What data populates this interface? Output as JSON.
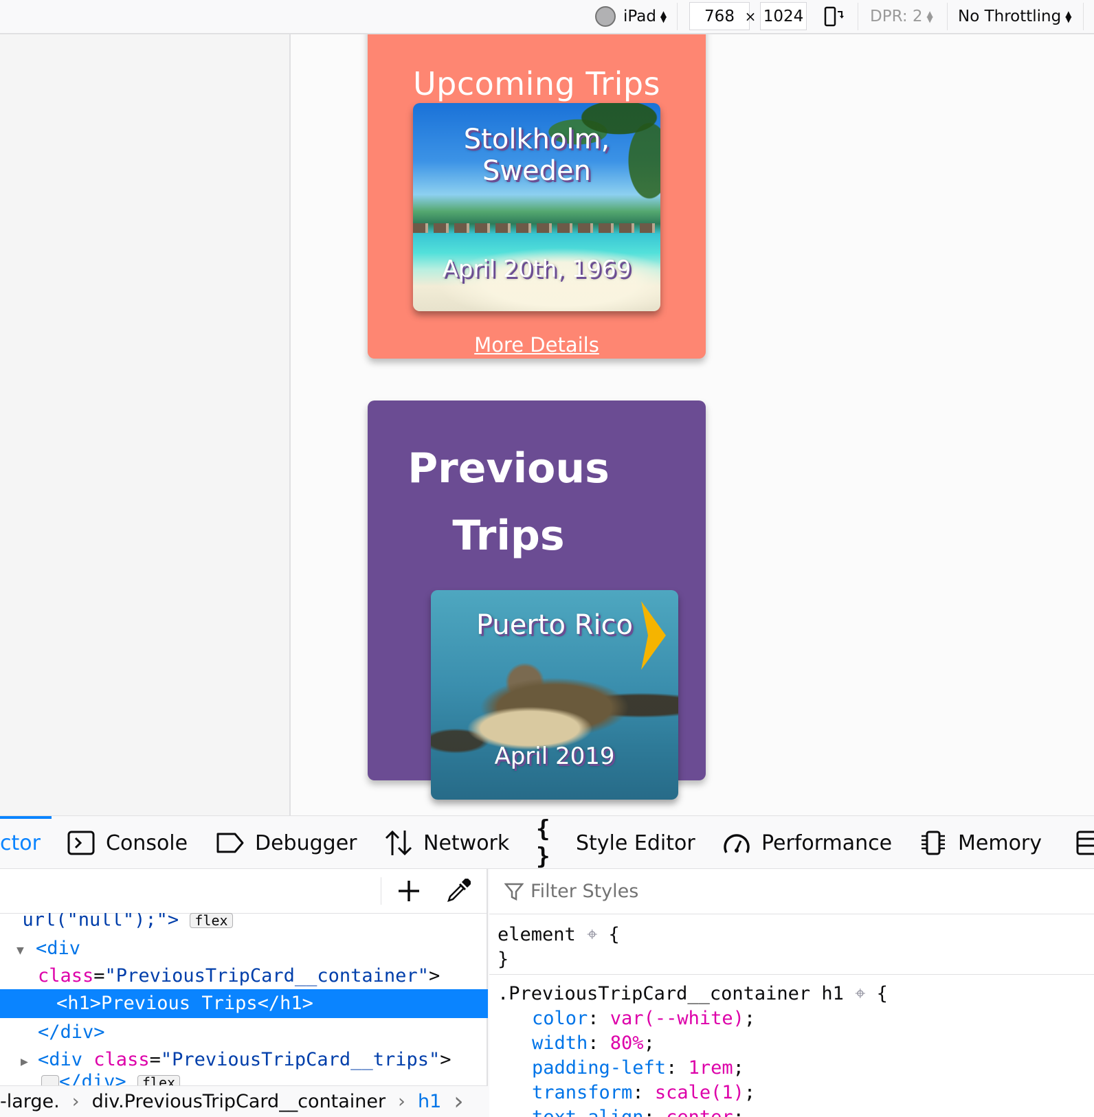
{
  "toolbar": {
    "device": "iPad",
    "width": "768",
    "times": "×",
    "height": "1024",
    "dpr": "DPR: 2",
    "throttling": "No Throttling"
  },
  "upcoming": {
    "title": "Upcoming Trips",
    "card_city": "Stolkholm, Sweden",
    "card_date": "April 20th, 1969",
    "more_link": "More Details"
  },
  "previous": {
    "title": "Previous Trips",
    "card_city": "Puerto Rico",
    "card_date": "April 2019"
  },
  "devtools": {
    "tabs": [
      {
        "label": "ctor",
        "icon": "inspector-icon"
      },
      {
        "label": "Console",
        "icon": "console-icon"
      },
      {
        "label": "Debugger",
        "icon": "debugger-icon"
      },
      {
        "label": "Network",
        "icon": "network-icon"
      },
      {
        "label": "Style Editor",
        "icon": "style-editor-icon"
      },
      {
        "label": "Performance",
        "icon": "performance-icon"
      },
      {
        "label": "Memory",
        "icon": "memory-icon"
      }
    ],
    "markup": {
      "line0_text": "url(\"null\");\">",
      "line0_badge": "flex",
      "div_open": "<div",
      "class_attr": "class",
      "eq": "=",
      "container_class": "\"PreviousTripCard__container\"",
      "gt": ">",
      "selected_line": "<h1>Previous Trips</h1>",
      "div_close": "</div>",
      "trips_class": "\"PreviousTripCard__trips\"",
      "ellipsis_badge": "…",
      "last_close": "</div>",
      "last_badge": "flex"
    },
    "breadcrumbs": [
      "-large.",
      "div.PreviousTripCard__container",
      "h1"
    ],
    "rules": {
      "filter_placeholder": "Filter Styles",
      "element_selector": "element",
      "open_brace": "{",
      "close_brace": "}",
      "rule_selector": ".PreviousTripCard__container h1",
      "declarations": [
        {
          "prop": "color",
          "value": "var(--white)"
        },
        {
          "prop": "width",
          "value": "80%"
        },
        {
          "prop": "padding-left",
          "value": "1rem"
        },
        {
          "prop": "transform",
          "value": "scale(1)"
        },
        {
          "prop": "text-align",
          "value": "center"
        }
      ]
    }
  },
  "colors": {
    "upcoming_card": "#fe8672",
    "previous_card": "#6b4c93",
    "devtools_accent": "#0a84ff",
    "chevron": "#f5b400"
  }
}
